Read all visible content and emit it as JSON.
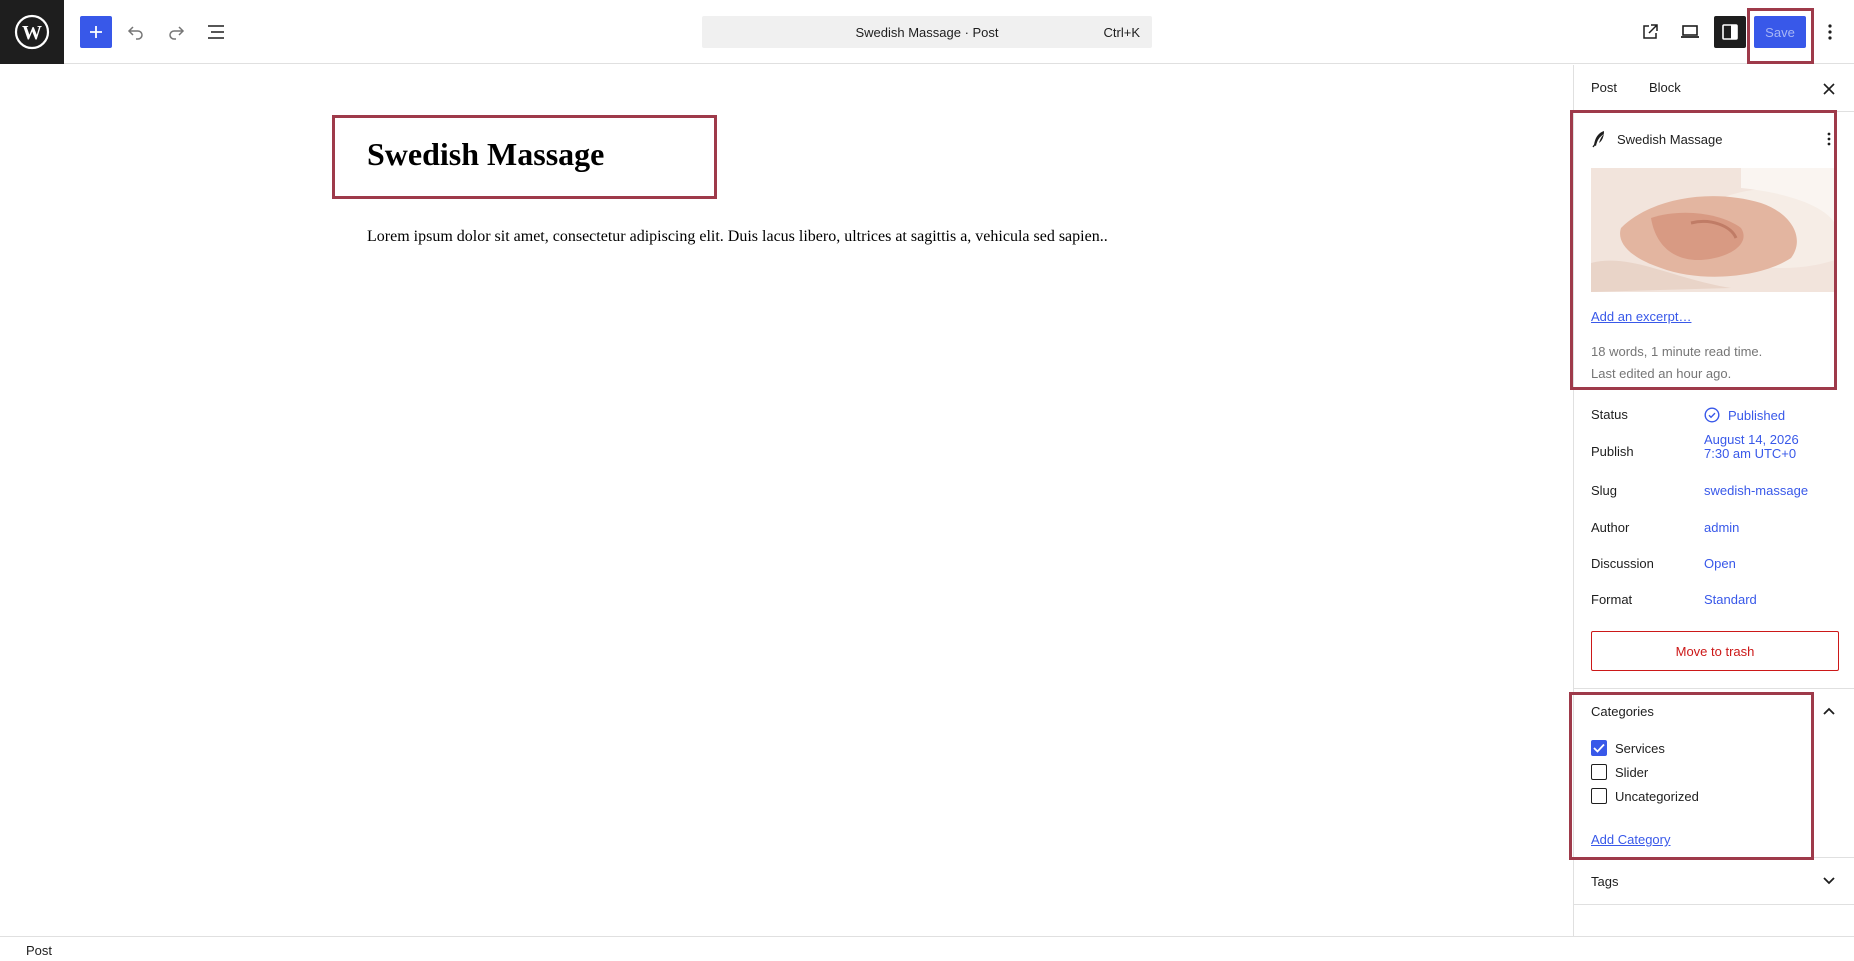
{
  "header": {
    "command_title": "Swedish Massage · Post",
    "command_shortcut": "Ctrl+K",
    "save_label": "Save"
  },
  "editor": {
    "title": "Swedish Massage",
    "paragraph": "Lorem ipsum dolor sit amet, consectetur adipiscing elit. Duis lacus libero, ultrices at sagittis a, vehicula sed sapien.."
  },
  "sidebar": {
    "tabs": {
      "post": "Post",
      "block": "Block"
    },
    "summary": {
      "title": "Swedish Massage",
      "excerpt_link": "Add an excerpt…",
      "word_count": "18 words, 1 minute read time.",
      "last_edited": "Last edited an hour ago."
    },
    "properties": {
      "status_label": "Status",
      "status_value": "Published",
      "publish_label": "Publish",
      "publish_date": "August 14, 2026",
      "publish_time": "7:30 am UTC+0",
      "slug_label": "Slug",
      "slug_value": "swedish-massage",
      "author_label": "Author",
      "author_value": "admin",
      "discussion_label": "Discussion",
      "discussion_value": "Open",
      "format_label": "Format",
      "format_value": "Standard"
    },
    "trash_label": "Move to trash",
    "categories": {
      "title": "Categories",
      "items": [
        {
          "label": "Services",
          "checked": true
        },
        {
          "label": "Slider",
          "checked": false
        },
        {
          "label": "Uncategorized",
          "checked": false
        }
      ],
      "add_link": "Add Category"
    },
    "tags": {
      "title": "Tags"
    }
  },
  "footer": {
    "breadcrumb": "Post"
  },
  "colors": {
    "accent": "#3858e9",
    "danger": "#cc1818",
    "highlight": "#9e3a4a",
    "dark": "#1e1e1e"
  }
}
